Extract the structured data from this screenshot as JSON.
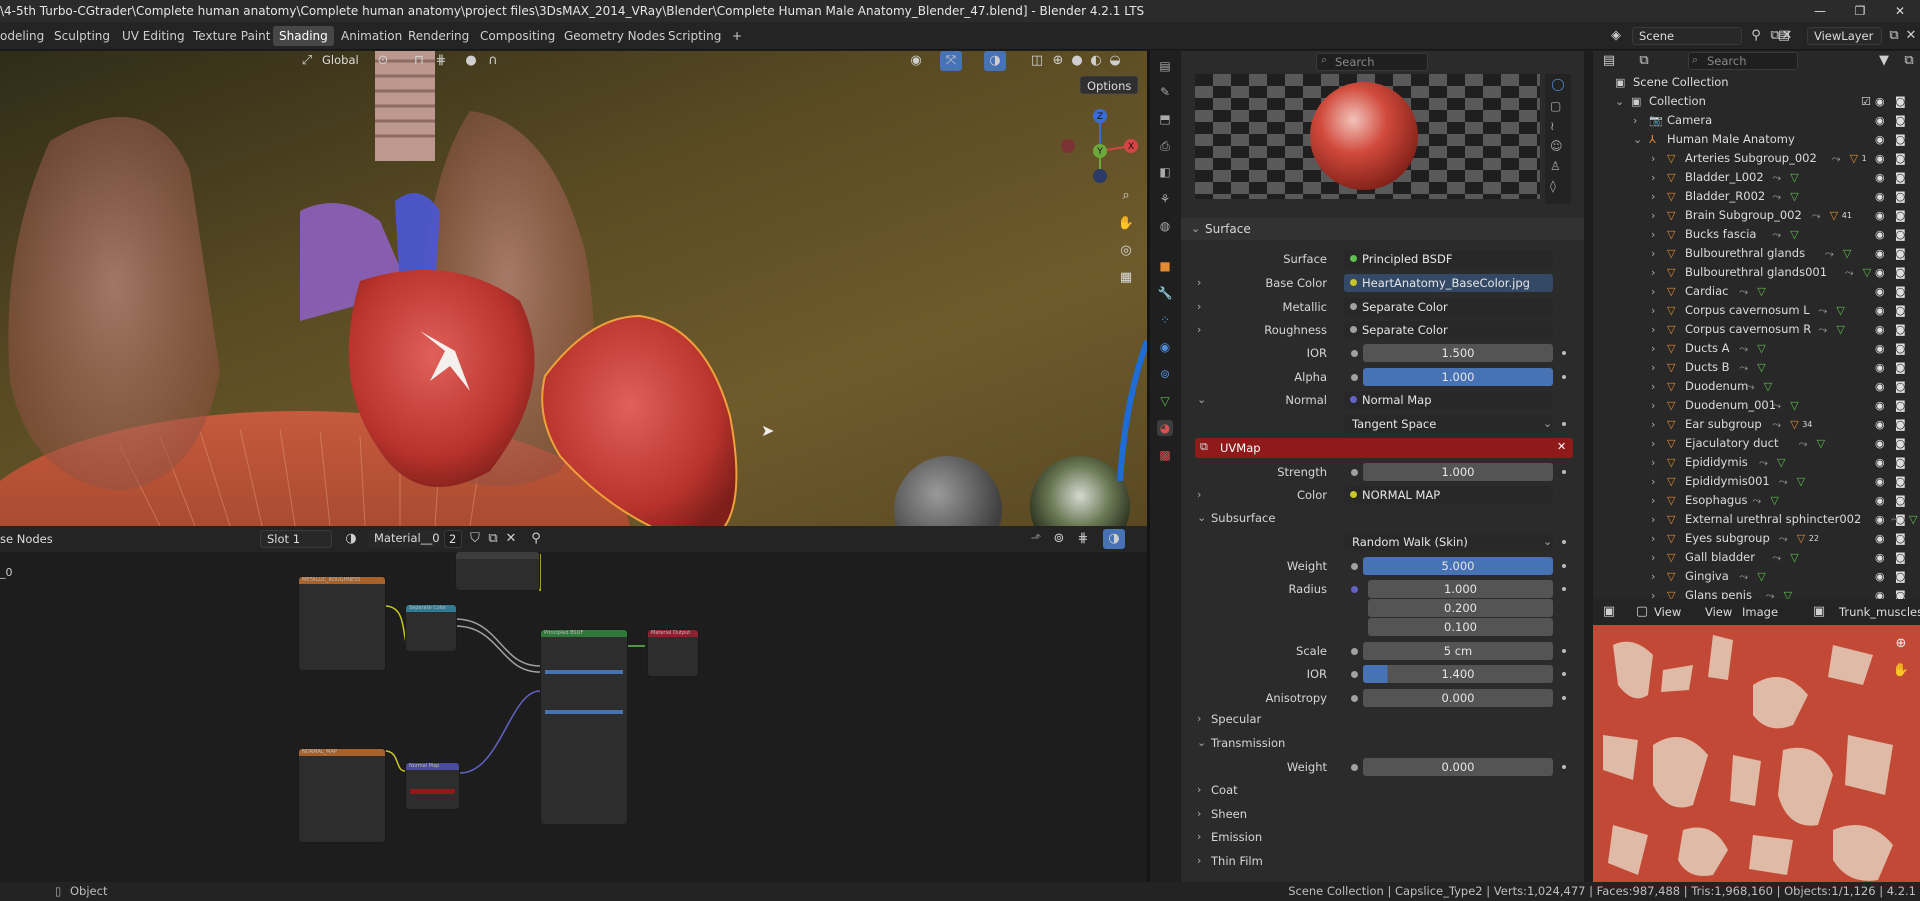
{
  "window": {
    "title": "\\4-5th Turbo-CGtrader\\Complete human anatomy\\Complete human anatomy\\project files\\3DsMAX_2014_VRay\\Blender\\Complete Human Male Anatomy_Blender_47.blend] - Blender 4.2.1 LTS",
    "min": "—",
    "max": "❐",
    "close": "✕"
  },
  "menubar": {
    "tabs": [
      "odeling",
      "Sculpting",
      "UV Editing",
      "Texture Paint",
      "Shading",
      "Animation",
      "Rendering",
      "Compositing",
      "Geometry Nodes",
      "Scripting"
    ],
    "active": "Shading",
    "add": "+"
  },
  "scene": {
    "label": "Scene",
    "viewlayer": "ViewLayer"
  },
  "viewport": {
    "orientation": "Global",
    "options": "Options",
    "gizmo": {
      "z": "Z",
      "y": "Y",
      "x": "X"
    }
  },
  "node_editor": {
    "title": "se Nodes",
    "slot": "Slot 1",
    "material": "Material__0",
    "users": "2",
    "left_label": "_0",
    "nodes": {
      "metal": "METALLIC_ROUGHNESS",
      "sep": "Separate Color",
      "bsdf": "Principled BSDF",
      "out": "Material Output",
      "normal": "NORMAL_MAP",
      "nmap": "Normal Map"
    }
  },
  "properties": {
    "search_placeholder": "Search",
    "surface_header": "Surface",
    "rows": [
      {
        "label": "Surface",
        "value": "Principled BSDF",
        "type": "link",
        "sock": "#5fbf4f"
      },
      {
        "label": "Base Color",
        "value": "HeartAnatomy_BaseColor.jpg",
        "type": "link",
        "sock": "#c7c729",
        "expand": ">"
      },
      {
        "label": "Metallic",
        "value": "Separate Color",
        "type": "link",
        "sock": "#a1a1a1",
        "expand": ">"
      },
      {
        "label": "Roughness",
        "value": "Separate Color",
        "type": "link",
        "sock": "#a1a1a1",
        "expand": ">"
      },
      {
        "label": "IOR",
        "value": "1.500",
        "type": "num",
        "sock": "#a1a1a1"
      },
      {
        "label": "Alpha",
        "value": "1.000",
        "type": "num",
        "sock": "#a1a1a1",
        "fill": 1.0
      },
      {
        "label": "Normal",
        "value": "Normal Map",
        "type": "link",
        "sock": "#6363c7",
        "expand": "v"
      }
    ],
    "tangent": "Tangent Space",
    "uvmap": "UVMap",
    "strength_label": "Strength",
    "strength": "1.000",
    "color_label": "Color",
    "color": "NORMAL MAP",
    "subsurface": "Subsurface",
    "sss_method": "Random Walk (Skin)",
    "weight_label": "Weight",
    "weight": "5.000",
    "radius_label": "Radius",
    "radius": [
      "1.000",
      "0.200",
      "0.100"
    ],
    "scale_label": "Scale",
    "scale": "5 cm",
    "ior2_label": "IOR",
    "ior2": "1.400",
    "aniso_label": "Anisotropy",
    "aniso": "0.000",
    "specular": "Specular",
    "transmission": "Transmission",
    "tweight_label": "Weight",
    "tweight": "0.000",
    "collapsed": [
      "Coat",
      "Sheen",
      "Emission",
      "Thin Film"
    ]
  },
  "outliner": {
    "search_placeholder": "Search",
    "root": "Scene Collection",
    "collection": "Collection",
    "items": [
      {
        "name": "Camera",
        "indent": 1,
        "extra": ""
      },
      {
        "name": "Human Male Anatomy",
        "indent": 1,
        "extra": ""
      },
      {
        "name": "Arteries Subgroup_002",
        "indent": 2,
        "extra": "1"
      },
      {
        "name": "Bladder_L002",
        "indent": 2,
        "extra": ""
      },
      {
        "name": "Bladder_R002",
        "indent": 2,
        "extra": ""
      },
      {
        "name": "Brain Subgroup_002",
        "indent": 2,
        "extra": "41"
      },
      {
        "name": "Bucks fascia",
        "indent": 2,
        "extra": ""
      },
      {
        "name": "Bulbourethral glands",
        "indent": 2,
        "extra": ""
      },
      {
        "name": "Bulbourethral glands001",
        "indent": 2,
        "extra": ""
      },
      {
        "name": "Cardiac",
        "indent": 2,
        "extra": ""
      },
      {
        "name": "Corpus cavernosum L",
        "indent": 2,
        "extra": ""
      },
      {
        "name": "Corpus cavernosum R",
        "indent": 2,
        "extra": ""
      },
      {
        "name": "Ducts A",
        "indent": 2,
        "extra": ""
      },
      {
        "name": "Ducts B",
        "indent": 2,
        "extra": ""
      },
      {
        "name": "Duodenum",
        "indent": 2,
        "extra": ""
      },
      {
        "name": "Duodenum_001",
        "indent": 2,
        "extra": ""
      },
      {
        "name": "Ear subgroup",
        "indent": 2,
        "extra": "34"
      },
      {
        "name": "Ejaculatory duct",
        "indent": 2,
        "extra": ""
      },
      {
        "name": "Epididymis",
        "indent": 2,
        "extra": ""
      },
      {
        "name": "Epididymis001",
        "indent": 2,
        "extra": ""
      },
      {
        "name": "Esophagus",
        "indent": 2,
        "extra": ""
      },
      {
        "name": "External urethral sphincter002",
        "indent": 2,
        "extra": ""
      },
      {
        "name": "Eyes subgroup",
        "indent": 2,
        "extra": "22"
      },
      {
        "name": "Gall bladder",
        "indent": 2,
        "extra": ""
      },
      {
        "name": "Gingiva",
        "indent": 2,
        "extra": ""
      },
      {
        "name": "Glans penis",
        "indent": 2,
        "extra": ""
      }
    ]
  },
  "image_editor": {
    "view": "View",
    "view2": "View",
    "image": "Image",
    "name": "Trunk_muscles"
  },
  "status": {
    "mode": "Object",
    "info": "Scene Collection | Capslice_Type2 | Verts:1,024,477 | Faces:987,488 | Tris:1,968,160 | Objects:1/1,126 | 4.2.1"
  }
}
